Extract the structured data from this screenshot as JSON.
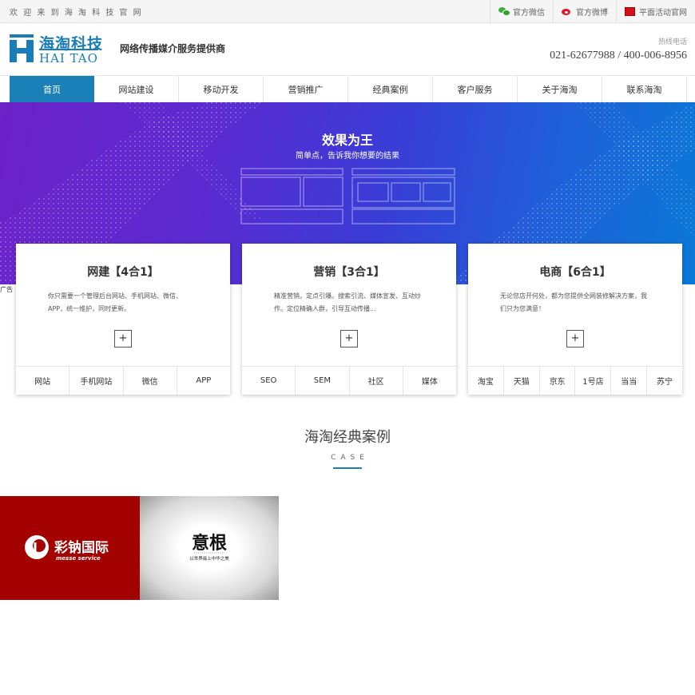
{
  "topbar": {
    "welcome": "欢 迎 来 到 海 淘 科 技 官 网",
    "links": [
      {
        "icon": "wechat-icon",
        "label": "官方微信"
      },
      {
        "icon": "weibo-icon",
        "label": "官方微博"
      },
      {
        "icon": "activity-icon",
        "label": "平面活动官网"
      }
    ]
  },
  "header": {
    "logo_cn": "海淘科技",
    "logo_en": "HAI TAO",
    "slogan": "网络传播媒介服务提供商",
    "hotline_label": "热线电话",
    "hotline_number": "021-62677988 / 400-006-8956"
  },
  "nav": [
    "首页",
    "网站建设",
    "移动开发",
    "营销推广",
    "经典案例",
    "客户服务",
    "关于海淘",
    "联系海淘"
  ],
  "banner": {
    "title": "效果为王",
    "subtitle": "简单点，告诉我你想要的结果",
    "ad_tag": "广告"
  },
  "cards": [
    {
      "title": "网建【4合1】",
      "desc": "你只需要一个管理后台网站、手机网站、微信、APP，统一维护，同时更新。",
      "plus": "+",
      "tags": [
        "网站",
        "手机网站",
        "微信",
        "APP"
      ]
    },
    {
      "title": "营销【3合1】",
      "desc": "精准营销，定点引爆。搜索引流、媒体宣发、互动炒作。定位精确人群，引导互动传播...",
      "plus": "+",
      "tags": [
        "SEO",
        "SEM",
        "社区",
        "媒体"
      ]
    },
    {
      "title": "电商【6合1】",
      "desc": "无论您店开何处，都为您提供全网装修解决方案，我们只为您满意！",
      "plus": "+",
      "tags": [
        "淘宝",
        "天猫",
        "京东",
        "1号店",
        "当当",
        "苏宁"
      ]
    }
  ],
  "cases": {
    "heading": "海淘经典案例",
    "sub": "CASE",
    "items": [
      {
        "name": "彩钠国际",
        "sub": "messe service"
      },
      {
        "name": "意根",
        "sub": "以世界级上中华之美"
      }
    ]
  },
  "colors": {
    "accent": "#1b80b8",
    "case1_bg": "#a30200"
  }
}
